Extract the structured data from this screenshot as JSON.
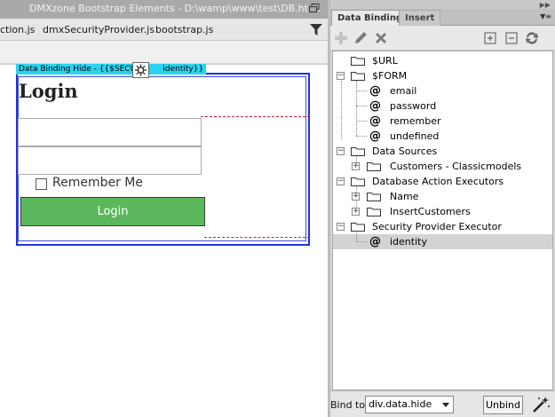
{
  "document": {
    "title": "DMXzone Bootstrap Elements - D:\\wamp\\www\\test\\DB.html",
    "files": [
      "ction.js",
      "dmxSecurityProvider.js",
      "bootstrap.js"
    ],
    "hide_label": "Data Binding Hide - {{$SECUR",
    "hide_label_tail": "identity}}",
    "heading": "Login",
    "remember_label": "Remember Me",
    "login_button": "Login"
  },
  "panel": {
    "tabs": [
      "Data Bindings",
      "Insert"
    ],
    "tree": [
      {
        "label": "$URL",
        "kind": "folder"
      },
      {
        "label": "$FORM",
        "kind": "folder",
        "expanded": true
      },
      {
        "label": "email",
        "kind": "field"
      },
      {
        "label": "password",
        "kind": "field"
      },
      {
        "label": "remember",
        "kind": "field"
      },
      {
        "label": "undefined",
        "kind": "field"
      },
      {
        "label": "Data Sources",
        "kind": "folder",
        "expanded": true
      },
      {
        "label": "Customers - Classicmodels",
        "kind": "folder"
      },
      {
        "label": "Database Action Executors",
        "kind": "folder",
        "expanded": true
      },
      {
        "label": "Name",
        "kind": "folder"
      },
      {
        "label": "InsertCustomers",
        "kind": "folder"
      },
      {
        "label": "Security Provider Executor",
        "kind": "folder",
        "expanded": true
      },
      {
        "label": "identity",
        "kind": "field",
        "selected": true
      }
    ],
    "bind_to_label": "Bind to:",
    "bind_to_value": "div.data.hide",
    "unbind_label": "Unbind"
  },
  "colors": {
    "hide_border": "#2333d6",
    "hide_label_bg": "#2ad4f0",
    "login_button": "#5cb85c",
    "dash": "#c71f3a",
    "selection": "#d3d3d3"
  }
}
